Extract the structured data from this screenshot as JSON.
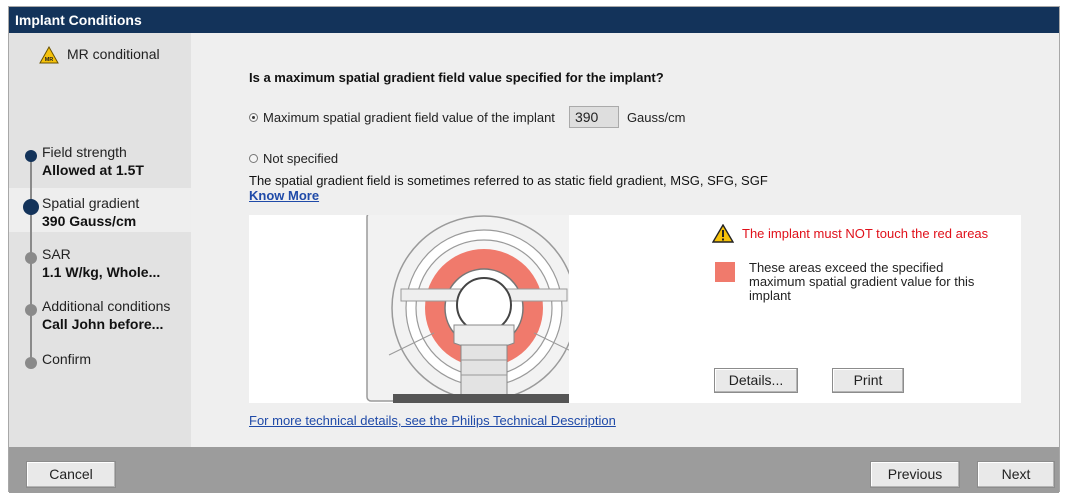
{
  "window": {
    "title": "Implant Conditions"
  },
  "sidebar": {
    "mr_status": "MR conditional",
    "mr_icon": "mr-conditional-warning-icon",
    "steps": [
      {
        "label": "Field strength",
        "value": "Allowed at 1.5T",
        "state": "done"
      },
      {
        "label": "Spatial gradient",
        "value": "390 Gauss/cm",
        "state": "current"
      },
      {
        "label": "SAR",
        "value": "1.1 W/kg, Whole...",
        "state": "pending"
      },
      {
        "label": "Additional conditions",
        "value": "Call John before...",
        "state": "pending"
      },
      {
        "label": "Confirm",
        "value": "",
        "state": "pending"
      }
    ]
  },
  "main": {
    "question": "Is a maximum spatial gradient field value specified for the implant?",
    "option_specified": {
      "label": "Maximum spatial gradient field value of the implant",
      "value": "390",
      "unit": "Gauss/cm",
      "selected": true
    },
    "option_not_specified": {
      "label": "Not specified",
      "selected": false
    },
    "info_text": "The spatial gradient field is sometimes referred to as static field gradient, MSG, SFG, SGF",
    "know_more": "Know More",
    "warning": "The implant must NOT touch the red areas",
    "legend_text": "These areas exceed the specified maximum spatial gradient value for this implant",
    "details_button": "Details...",
    "print_button": "Print",
    "tech_link": "For more technical details, see the Philips Technical Description"
  },
  "footer": {
    "cancel": "Cancel",
    "previous": "Previous",
    "next": "Next"
  },
  "colors": {
    "titlebar": "#13335a",
    "accent_dot": "#13335a",
    "warning_red": "#e0101a",
    "danger_area": "#f07a6c",
    "link": "#1f4aa8"
  }
}
